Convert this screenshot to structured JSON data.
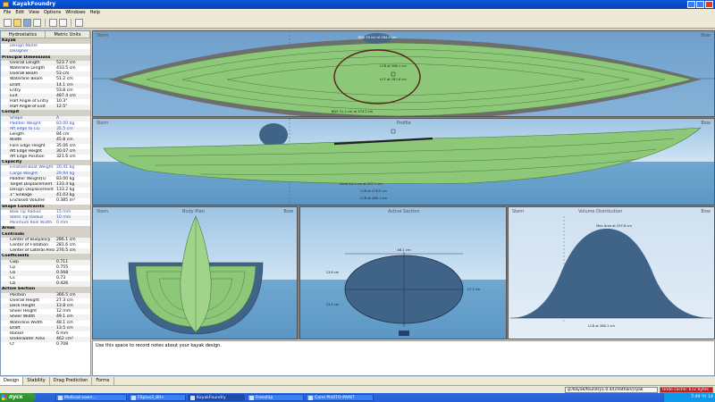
{
  "window": {
    "title": "KayakFoundry"
  },
  "menu": [
    "File",
    "Edit",
    "View",
    "Options",
    "Windows",
    "Help"
  ],
  "left_panel": {
    "tabs": [
      "Hydrostatics",
      "Metric Units"
    ],
    "rows": [
      {
        "type": "sec",
        "k": "Kayak"
      },
      {
        "type": "blue",
        "k": "Design Name",
        "v": ""
      },
      {
        "type": "blue",
        "k": "Designer",
        "v": ""
      },
      {
        "type": "sec",
        "k": "Principal Dimensions"
      },
      {
        "k": "Overall Length",
        "v": "523.7 cm"
      },
      {
        "k": "Waterline Length",
        "v": "433.5 cm"
      },
      {
        "k": "Overall Beam",
        "v": "53 cm"
      },
      {
        "k": "Waterline Beam",
        "v": "51.2 cm"
      },
      {
        "k": "Draft",
        "v": "14.1 cm"
      },
      {
        "k": "Entry",
        "v": "53.8 cm"
      },
      {
        "k": "Exit",
        "v": "487.4 cm"
      },
      {
        "k": "Half Angle of Entry",
        "v": "10.3°"
      },
      {
        "k": "Half Angle of Exit",
        "v": "12.5°"
      },
      {
        "type": "sec",
        "k": "Cockpit"
      },
      {
        "type": "blue",
        "k": "Shape",
        "v": "A"
      },
      {
        "type": "blue",
        "k": "Paddler Weight",
        "v": "83.00 kg"
      },
      {
        "type": "blue",
        "k": "Aft edge to CG",
        "v": "35.5 cm"
      },
      {
        "k": "Length",
        "v": "84 cm"
      },
      {
        "k": "Width",
        "v": "45.8 cm"
      },
      {
        "k": "Fore Edge Height",
        "v": "35.06 cm"
      },
      {
        "k": "Aft Edge Height",
        "v": "30.07 cm"
      },
      {
        "k": "Aft Edge Position",
        "v": "321.6 cm"
      },
      {
        "type": "sec",
        "k": "Capacity"
      },
      {
        "type": "blue",
        "k": "Finished Boat Weight",
        "v": "20.41 kg"
      },
      {
        "type": "blue",
        "k": "Cargo Weight",
        "v": "29.94 kg"
      },
      {
        "k": "Paddler Weight(s)",
        "v": "83.00 kg"
      },
      {
        "k": "Target Displacement",
        "v": "133.4 kg"
      },
      {
        "k": "Design Displacement",
        "v": "133.2 kg"
      },
      {
        "k": "1\" Sinkage",
        "v": "41.03 kg"
      },
      {
        "k": "Enclosed Volume",
        "v": "0.385 m³"
      },
      {
        "type": "sec",
        "k": "Shape Constraints"
      },
      {
        "type": "blue",
        "k": "Bow Tip Radius",
        "v": "15 mm"
      },
      {
        "type": "blue",
        "k": "Stern Tip Radius",
        "v": "10 mm"
      },
      {
        "type": "blue",
        "k": "Minimum Keel Width",
        "v": "0 mm"
      },
      {
        "type": "sec",
        "k": "Areas"
      },
      {
        "type": "sec",
        "k": "Centroids"
      },
      {
        "k": "Center of Buoyancy",
        "v": "286.1 cm"
      },
      {
        "k": "Center of Flotation",
        "v": "281.6 cm"
      },
      {
        "k": "Center of Lateral Area",
        "v": "276.5 cm"
      },
      {
        "type": "sec",
        "k": "Coefficients"
      },
      {
        "k": "Cwp",
        "v": "0.711"
      },
      {
        "k": "Cp",
        "v": "0.755"
      },
      {
        "k": "Cb",
        "v": "0.568"
      },
      {
        "k": "Cs",
        "v": "0.73"
      },
      {
        "k": "Cb",
        "v": "0.426"
      },
      {
        "type": "sec",
        "k": "Active Section"
      },
      {
        "k": "Position",
        "v": "366.5 cm"
      },
      {
        "k": "Overall Height",
        "v": "27.3 cm"
      },
      {
        "k": "Deck Height",
        "v": "13.8 cm"
      },
      {
        "k": "Sheer Height",
        "v": "12 mm"
      },
      {
        "k": "Sheer Width",
        "v": "49.1 cm"
      },
      {
        "k": "Waterline Width",
        "v": "48.1 cm"
      },
      {
        "k": "Draft",
        "v": "13.5 cm"
      },
      {
        "k": "Rocker",
        "v": "6 mm"
      },
      {
        "k": "Underwater Area",
        "v": "462 cm²"
      },
      {
        "k": "Cf",
        "v": "0.708"
      }
    ]
  },
  "plan_view": {
    "label_left": "Stern",
    "label_right": "Bow",
    "ann_top": "BOA 53 cm at 284.4 cm",
    "ann_lcb": "LCB at 286.1 cm",
    "ann_lcf": "LCF at 281.6 cm",
    "ann_bwl": "BWL 51.2 cm at 274.2 cm"
  },
  "profile_view": {
    "label_left": "Stern",
    "label_center": "Profile",
    "label_right": "Bow",
    "ann_draft": "Draft 14.1 cm at 297.7 cm",
    "ann_clr": "CLR at 276.5 cm",
    "ann_lcb": "LCB at 286.1 cm"
  },
  "body_plan": {
    "label_left": "Stern",
    "label_center": "Body Plan",
    "label_right": "Bow"
  },
  "active_section": {
    "label_center": "Active Section",
    "ann_width": "48.1 cm",
    "ann_left_top": "13.8 cm",
    "ann_left_bottom": "13.5 cm",
    "ann_right": "27.3 cm"
  },
  "volume": {
    "label_left": "Stern",
    "label_center": "Volume Distribution",
    "label_right": "Bow",
    "ann_max": "Max Area at 297.8 cm",
    "ann_lcb": "LCB at 286.1 cm"
  },
  "notes": {
    "text": "Use this space to record notes about your kayak design."
  },
  "bottom_tabs": [
    "Design",
    "Stability",
    "Drag Prediction",
    "Forms"
  ],
  "status": {
    "path": "g:/kayak/foundry1.0.4/[chathan/]Tyak",
    "cache": "Undo cache: 672 bytes"
  },
  "taskbar": {
    "start": "пуск",
    "tasks": [
      "Мобсой комп...",
      "FSplus3_80+",
      "KayakFoundry",
      "Freeship",
      "Corel PHOTO-PAINT"
    ],
    "clock": "7:49 Чт 14"
  },
  "colors": {
    "hull_green": "#8cc878",
    "water": "#6ea8d0",
    "dark_hull": "#3f6488"
  }
}
